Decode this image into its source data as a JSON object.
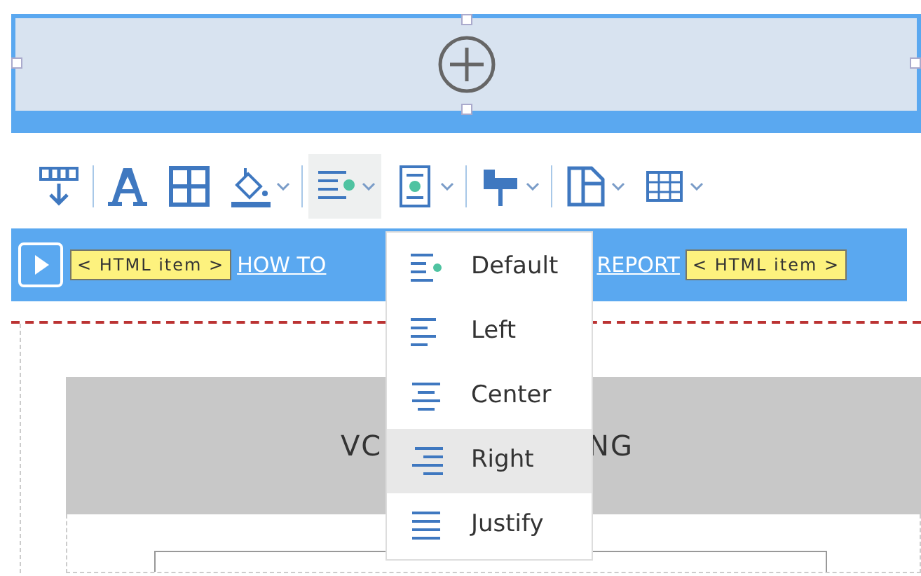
{
  "toolbar": {
    "buttons": [
      {
        "kind": "insert-row",
        "caret": false,
        "active": false
      },
      {
        "kind": "font",
        "caret": false,
        "active": false
      },
      {
        "kind": "table",
        "caret": false,
        "active": false
      },
      {
        "kind": "fill",
        "caret": true,
        "active": false
      },
      {
        "kind": "align",
        "caret": true,
        "active": true
      },
      {
        "kind": "valign",
        "caret": true,
        "active": false
      },
      {
        "kind": "pin",
        "caret": true,
        "active": false
      },
      {
        "kind": "page",
        "caret": true,
        "active": false
      },
      {
        "kind": "grid",
        "caret": true,
        "active": false
      }
    ]
  },
  "html_items": [
    "< HTML item >",
    "< HTML item >"
  ],
  "link_parts": [
    "HOW TO",
    "REPORT"
  ],
  "header_parts": [
    "VC",
    "NG"
  ],
  "align_menu": [
    {
      "label": "Default",
      "kind": "default",
      "selected": false
    },
    {
      "label": "Left",
      "kind": "left",
      "selected": false
    },
    {
      "label": "Center",
      "kind": "center",
      "selected": false
    },
    {
      "label": "Right",
      "kind": "right",
      "selected": true
    },
    {
      "label": "Justify",
      "kind": "justify",
      "selected": false
    }
  ]
}
